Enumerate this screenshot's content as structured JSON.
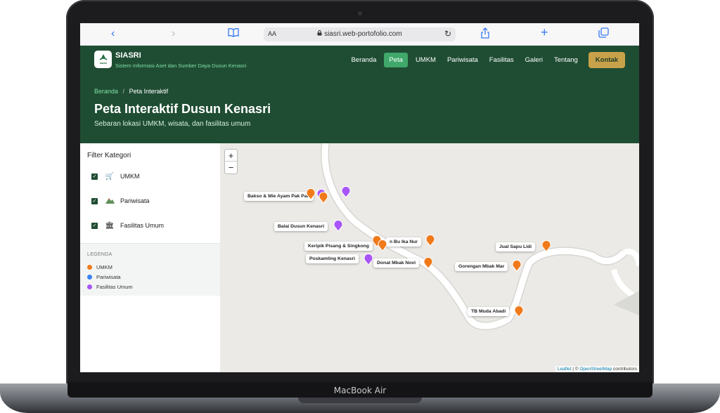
{
  "device": {
    "label": "MacBook Air"
  },
  "browser": {
    "aa_label": "AA",
    "url": "siasri.web-portofolio.com",
    "icons": [
      "chevron-left-icon",
      "chevron-right-icon",
      "book-icon",
      "lock-icon",
      "reload-icon",
      "share-icon",
      "plus-icon",
      "tabs-icon"
    ]
  },
  "site": {
    "logo_text": "SIASRI",
    "logo_mark": "siasri",
    "tagline": "Sistem Informasi Aset dan Sumber Daya Dusun Kenasri",
    "nav": [
      {
        "label": "Beranda",
        "active": false
      },
      {
        "label": "Peta",
        "active": true
      },
      {
        "label": "UMKM",
        "active": false
      },
      {
        "label": "Pariwisata",
        "active": false
      },
      {
        "label": "Fasilitas",
        "active": false
      },
      {
        "label": "Galeri",
        "active": false
      },
      {
        "label": "Tentang",
        "active": false
      }
    ],
    "cta": "Kontak"
  },
  "hero": {
    "breadcrumb_home": "Beranda",
    "breadcrumb_sep": "/",
    "breadcrumb_current": "Peta Interaktif",
    "title": "Peta Interaktif Dusun Kenasri",
    "subtitle": "Sebaran lokasi UMKM, wisata, dan fasilitas umum"
  },
  "sidebar": {
    "filter_title": "Filter Kategori",
    "filters": [
      {
        "label": "UMKM",
        "checked": true,
        "icon": "cart-icon"
      },
      {
        "label": "Pariwisata",
        "checked": true,
        "icon": "mountain-icon"
      },
      {
        "label": "Fasilitas Umum",
        "checked": true,
        "icon": "building-icon"
      }
    ],
    "legend_title": "LEGENDA",
    "legend": [
      {
        "label": "UMKM",
        "color": "#f07a1a"
      },
      {
        "label": "Pariwisata",
        "color": "#3b82f6"
      },
      {
        "label": "Fasilitas Umum",
        "color": "#a855f7"
      }
    ]
  },
  "map": {
    "zoom_in": "+",
    "zoom_out": "−",
    "labels": [
      "Bakso & Mie Ayam Pak Palt",
      "Balai Dusun Kenasri",
      "Keripik Pisang & Singkong",
      "Poskamling Kenasri",
      "Donat Mbak Novi",
      "n Bu Ika Nur",
      "Jual Sapu Lidi",
      "Gorengan Mbak Mar",
      "TB Muda Abadi"
    ],
    "attribution": {
      "leaflet": "Leaflet",
      "sep": "| ©",
      "osm": "OpenStreetMap",
      "suffix": "contributors"
    }
  },
  "colors": {
    "umkm": "#f07a1a",
    "fasilitas": "#a855f7",
    "header": "#1f4d33",
    "accent": "#3fa86a",
    "cta": "#c8a24a"
  }
}
